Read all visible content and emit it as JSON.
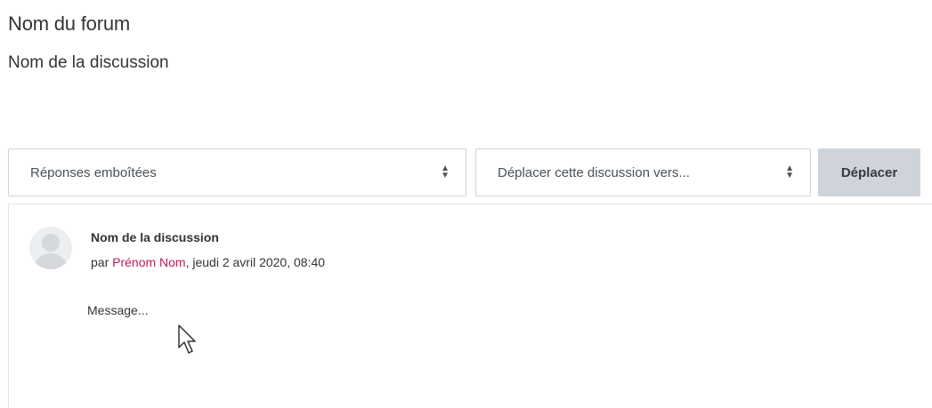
{
  "forum": {
    "name": "Nom du forum",
    "discussion_name": "Nom de la discussion"
  },
  "controls": {
    "display_mode": "Réponses emboîtées",
    "move_select": "Déplacer cette discussion vers...",
    "move_button": "Déplacer"
  },
  "post": {
    "subject": "Nom de la discussion",
    "by_prefix": "par ",
    "author": "Prénom Nom",
    "date": ", jeudi 2 avril 2020, 08:40",
    "message": "Message..."
  },
  "colors": {
    "author_link": "#c2185b",
    "button_bg": "#ced4da"
  },
  "icons": {
    "select_caret": "sort-caret-icon",
    "avatar": "default-user-avatar-icon",
    "cursor": "mouse-pointer-icon"
  }
}
